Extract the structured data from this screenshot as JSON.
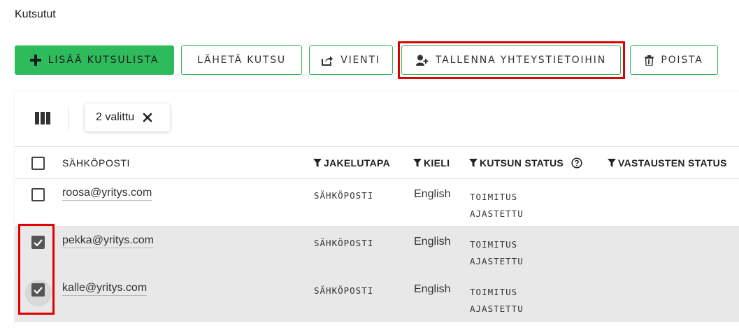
{
  "page": {
    "title": "Kutsutut"
  },
  "toolbar": {
    "add_label": "LISÄÄ KUTSULISTA",
    "send_label": "LÄHETÄ KUTSU",
    "export_label": "VIENTI",
    "save_contacts_label": "TALLENNA YHTEYSTIETOIHIN",
    "delete_label": "POISTA"
  },
  "selection": {
    "chip_label": "2 valittu"
  },
  "table": {
    "headers": {
      "email": "SÄHKÖPOSTI",
      "method": "JAKELUTAPA",
      "language": "KIELI",
      "invite_status": "KUTSUN STATUS",
      "response_status": "VASTAUSTEN STATUS"
    },
    "rows": [
      {
        "email": "roosa@yritys.com",
        "method": "SÄHKÖPOSTI",
        "language": "English",
        "status": "TOIMITUS AJASTETTU",
        "checked": false
      },
      {
        "email": "pekka@yritys.com",
        "method": "SÄHKÖPOSTI",
        "language": "English",
        "status": "TOIMITUS AJASTETTU",
        "checked": true
      },
      {
        "email": "kalle@yritys.com",
        "method": "SÄHKÖPOSTI",
        "language": "English",
        "status": "TOIMITUS AJASTETTU",
        "checked": true
      }
    ]
  },
  "colors": {
    "accent": "#2dbb5c",
    "highlight": "#e00000",
    "selected_row": "#e8e8e8"
  },
  "icons": [
    "plus-icon",
    "share-icon",
    "add-user-icon",
    "trash-icon",
    "columns-icon",
    "close-icon",
    "filter-icon",
    "help-icon",
    "check-icon"
  ]
}
